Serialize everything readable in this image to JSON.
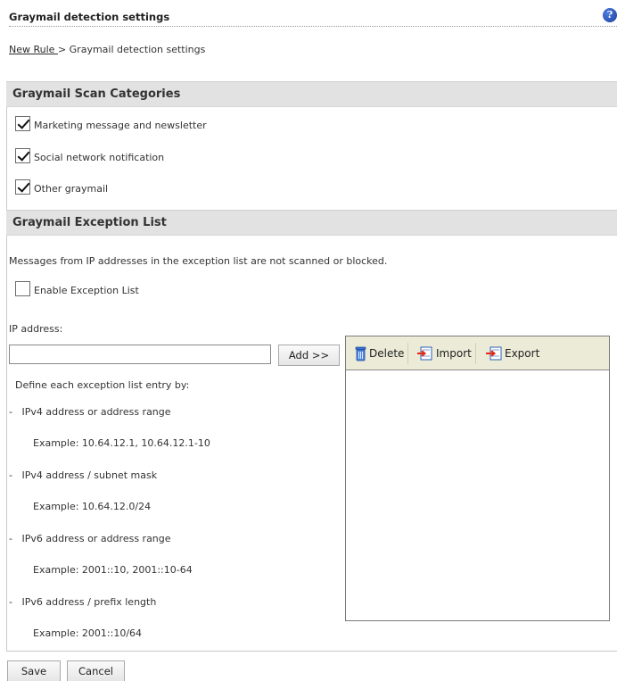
{
  "header": {
    "title": "Graymail detection settings",
    "help_icon": "help-icon"
  },
  "breadcrumb": {
    "link": "New Rule ",
    "separator": ">",
    "current": "Graymail detection settings"
  },
  "scan_categories": {
    "title": "Graymail Scan Categories",
    "items": [
      {
        "label": "Marketing message and newsletter",
        "checked": true
      },
      {
        "label": "Social network notification",
        "checked": true
      },
      {
        "label": "Other graymail",
        "checked": true
      }
    ]
  },
  "exception_list": {
    "title": "Graymail Exception List",
    "description": "Messages from IP addresses in the exception list are not scanned or blocked.",
    "enable_label": "Enable Exception List",
    "enable_checked": false,
    "ip_label": "IP address:",
    "ip_value": "",
    "add_label": "Add >>",
    "toolbar": {
      "delete": "Delete",
      "import": "Import",
      "export": "Export"
    },
    "define_heading": "Define each exception list entry by:",
    "entries": [
      {
        "bullet": "-",
        "label": "IPv4 address or address range",
        "example": "Example: 10.64.12.1, 10.64.12.1-10"
      },
      {
        "bullet": "-",
        "label": "IPv4 address / subnet mask",
        "example": "Example: 10.64.12.0/24"
      },
      {
        "bullet": "-",
        "label": "IPv6 address or address range",
        "example": "Example: 2001::10, 2001::10-64"
      },
      {
        "bullet": "-",
        "label": "IPv6 address / prefix length",
        "example": "Example: 2001::10/64"
      }
    ]
  },
  "footer": {
    "save": "Save",
    "cancel": "Cancel"
  }
}
